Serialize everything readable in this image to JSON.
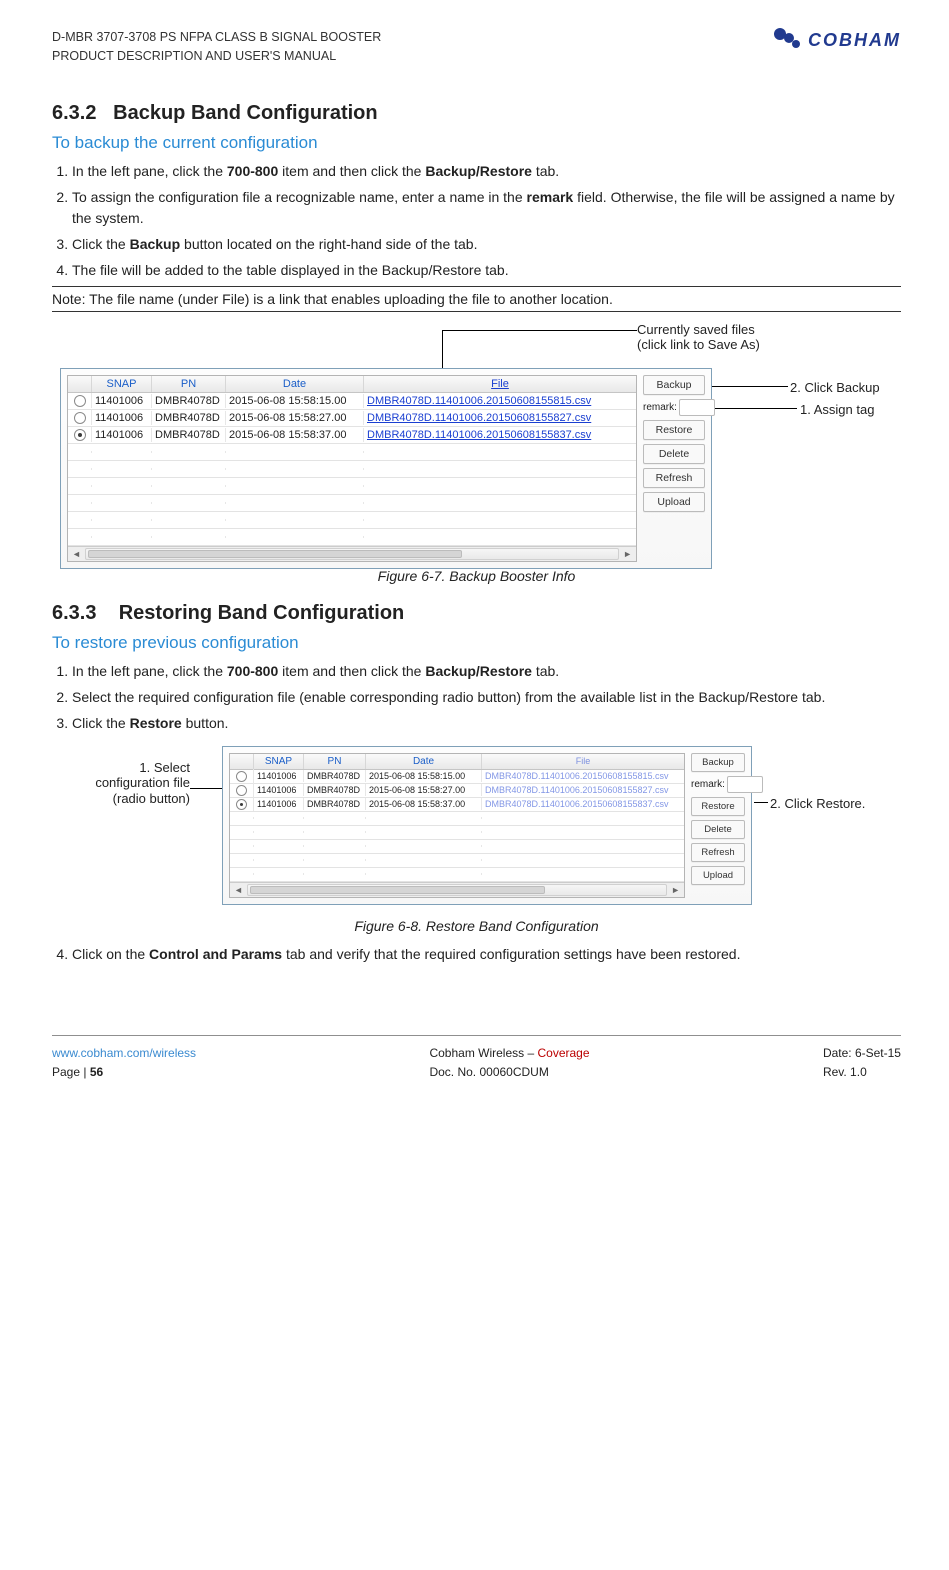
{
  "header": {
    "line1": "D-MBR 3707-3708 PS NFPA CLASS B SIGNAL BOOSTER",
    "line2": "PRODUCT DESCRIPTION AND USER'S MANUAL",
    "logo_text": "COBHAM"
  },
  "sec_backup": {
    "num": "6.3.2",
    "title": "Backup Band Configuration",
    "subhead": "To backup the current configuration",
    "steps": [
      {
        "pre": "In the left pane, click the ",
        "b1": "700-800",
        "mid": " item and then click the ",
        "b2": "Backup/Restore",
        "post": " tab."
      },
      {
        "pre": "To assign the configuration file a recognizable name, enter a name in the ",
        "b1": "remark",
        "mid": "",
        "b2": "",
        "post": " field. Otherwise, the file will be assigned a name by the system."
      },
      {
        "pre": "Click the ",
        "b1": "Backup",
        "mid": "",
        "b2": "",
        "post": " button located on the right-hand side of the tab."
      },
      {
        "pre": "The file will be added to the table displayed in the Backup/Restore tab.",
        "b1": "",
        "mid": "",
        "b2": "",
        "post": ""
      }
    ],
    "note": "Note: The file name (under File) is a link that enables uploading the file to another location."
  },
  "fig1": {
    "caption": "Figure 6-7. Backup Booster Info",
    "annot_saved_files_l1": "Currently saved files",
    "annot_saved_files_l2": "(click link to Save As)",
    "annot_click_backup": "2. Click Backup",
    "annot_assign_tag": "1. Assign tag",
    "panel": {
      "headers": {
        "snap": "SNAP",
        "pn": "PN",
        "date": "Date",
        "file": "File"
      },
      "rows": [
        {
          "sel": false,
          "snap": "11401006",
          "pn": "DMBR4078D",
          "date": "2015-06-08 15:58:15.00",
          "file": "DMBR4078D.11401006.20150608155815.csv"
        },
        {
          "sel": false,
          "snap": "11401006",
          "pn": "DMBR4078D",
          "date": "2015-06-08 15:58:27.00",
          "file": "DMBR4078D.11401006.20150608155827.csv"
        },
        {
          "sel": true,
          "snap": "11401006",
          "pn": "DMBR4078D",
          "date": "2015-06-08 15:58:37.00",
          "file": "DMBR4078D.11401006.20150608155837.csv"
        }
      ],
      "buttons": {
        "backup": "Backup",
        "remark_lbl": "remark:",
        "restore": "Restore",
        "delete": "Delete",
        "refresh": "Refresh",
        "upload": "Upload"
      }
    }
  },
  "sec_restore": {
    "num": "6.3.3",
    "title": "Restoring Band Configuration",
    "subhead": "To restore previous configuration",
    "steps": [
      {
        "pre": "In the left pane, click the ",
        "b1": "700-800",
        "mid": " item and then click the ",
        "b2": "Backup/Restore",
        "post": " tab."
      },
      {
        "pre": "Select the required configuration file (enable corresponding radio button) from the available list in the Backup/Restore tab.",
        "b1": "",
        "mid": "",
        "b2": "",
        "post": ""
      },
      {
        "pre": "Click the ",
        "b1": "Restore",
        "mid": "",
        "b2": "",
        "post": " button."
      }
    ],
    "step4": {
      "pre": "Click on the ",
      "b1": "Control and Params",
      "post": " tab and verify that the required configuration settings have been restored."
    }
  },
  "fig2": {
    "caption": "Figure 6-8. Restore Band Configuration",
    "annot_select_l1": "1. Select",
    "annot_select_l2": "configuration file",
    "annot_select_l3": "(radio button)",
    "annot_click_restore": "2. Click Restore.",
    "panel": {
      "headers": {
        "snap": "SNAP",
        "pn": "PN",
        "date": "Date",
        "file": "File"
      },
      "rows": [
        {
          "sel": false,
          "snap": "11401006",
          "pn": "DMBR4078D",
          "date": "2015-06-08 15:58:15.00",
          "file": "DMBR4078D.11401006.20150608155815.csv"
        },
        {
          "sel": false,
          "snap": "11401006",
          "pn": "DMBR4078D",
          "date": "2015-06-08 15:58:27.00",
          "file": "DMBR4078D.11401006.20150608155827.csv"
        },
        {
          "sel": true,
          "snap": "11401006",
          "pn": "DMBR4078D",
          "date": "2015-06-08 15:58:37.00",
          "file": "DMBR4078D.11401006.20150608155837.csv"
        }
      ],
      "buttons": {
        "backup": "Backup",
        "remark_lbl": "remark:",
        "restore": "Restore",
        "delete": "Delete",
        "refresh": "Refresh",
        "upload": "Upload"
      }
    }
  },
  "footer": {
    "url": "www.cobham.com/wireless",
    "page": "Page | 56",
    "center1a": "Cobham Wireless – ",
    "center1b": "Coverage",
    "center2": "Doc. No. 00060CDUM",
    "right1": "Date: 6-Set-15",
    "right2": "Rev. 1.0"
  }
}
